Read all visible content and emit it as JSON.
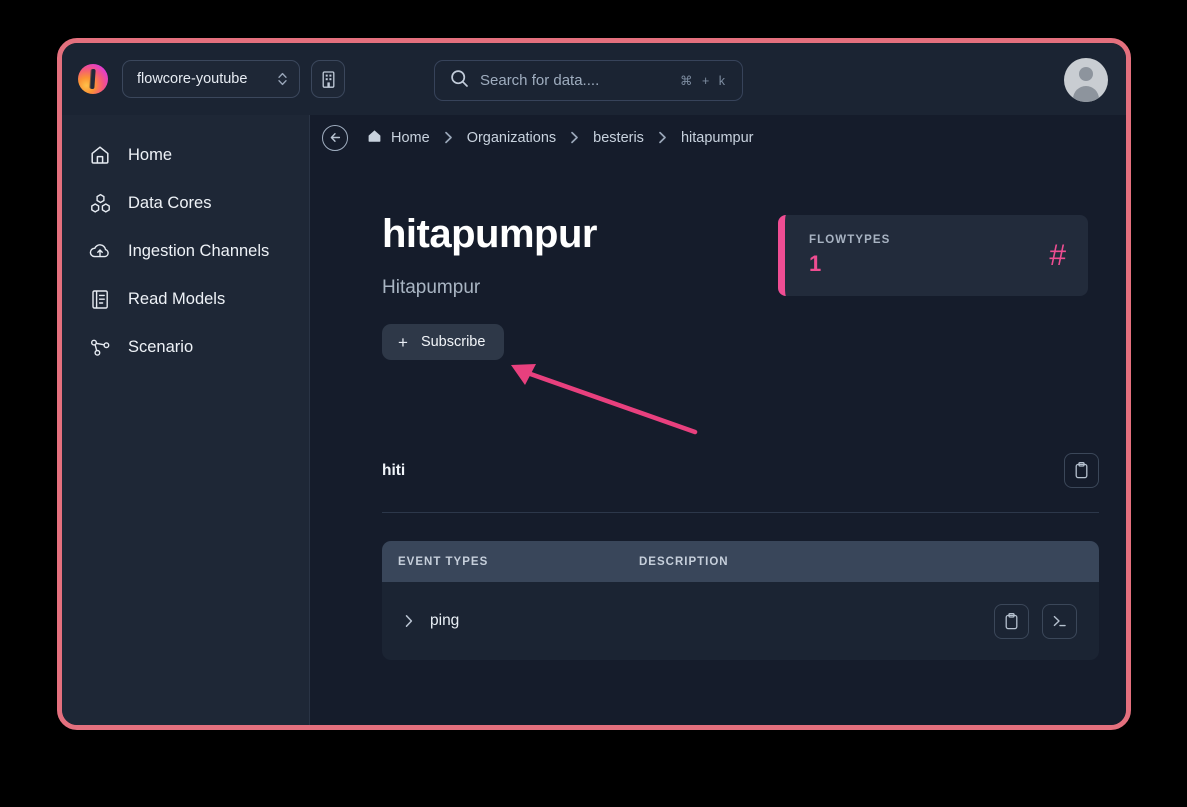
{
  "theme": {
    "window_border": "#e4707e",
    "accent_pink": "#ee4d91",
    "sidebar_bg": "#1e2736",
    "content_bg": "#151c2b",
    "topbar_bg": "#1b2433",
    "annotation_arrow": "#e8407e"
  },
  "topbar": {
    "logo_name": "flowcore-logo",
    "org_switcher": {
      "value": "flowcore-youtube",
      "icon": "chevron-up-down-icon"
    },
    "org_icon_button": "building-icon",
    "search": {
      "placeholder": "Search for data....",
      "icon": "search-icon",
      "shortcut": "⌘ + k"
    },
    "avatar": "user-avatar"
  },
  "sidebar": {
    "items": [
      {
        "label": "Home",
        "icon": "home-icon"
      },
      {
        "label": "Data Cores",
        "icon": "cubes-icon"
      },
      {
        "label": "Ingestion Channels",
        "icon": "cloud-upload-icon"
      },
      {
        "label": "Read Models",
        "icon": "book-icon"
      },
      {
        "label": "Scenario",
        "icon": "node-graph-icon"
      }
    ]
  },
  "breadcrumb": {
    "back_icon": "arrow-left-icon",
    "separator": "›",
    "items": [
      {
        "label": "Home",
        "icon": "home-icon"
      },
      {
        "label": "Organizations"
      },
      {
        "label": "besteris"
      },
      {
        "label": "hitapumpur"
      }
    ]
  },
  "main": {
    "title": "hitapumpur",
    "subtitle": "Hitapumpur",
    "subscribe_button": {
      "label": "Subscribe",
      "icon": "plus-icon"
    },
    "stat_card": {
      "label": "FLOWTYPES",
      "value": "1",
      "icon": "hash-icon"
    },
    "flowtype": {
      "name": "hiti",
      "copy_button": "clipboard-icon",
      "table": {
        "columns": [
          "EVENT TYPES",
          "DESCRIPTION"
        ],
        "rows": [
          {
            "expand_icon": "chevron-right-icon",
            "event_type": "ping",
            "description": "",
            "actions": [
              "clipboard-icon",
              "terminal-icon"
            ]
          }
        ]
      }
    }
  }
}
